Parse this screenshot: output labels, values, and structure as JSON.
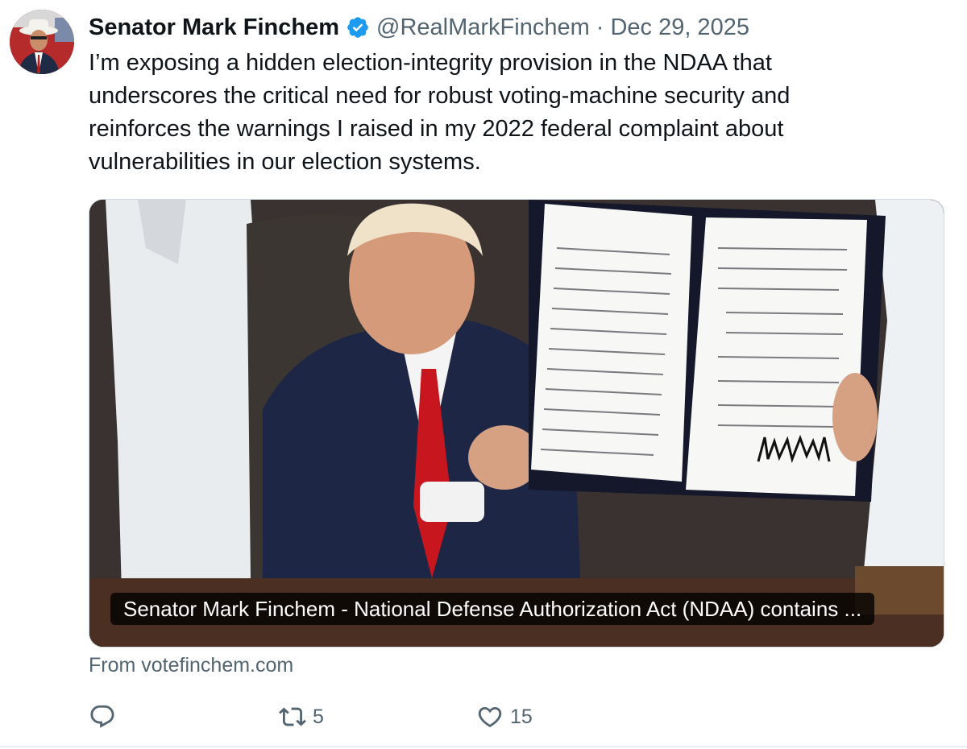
{
  "tweet": {
    "author_name": "Senator Mark Finchem",
    "handle": "@RealMarkFinchem",
    "separator": "·",
    "date": "Dec 29, 2025",
    "verified": true,
    "text_lines": [
      "I’m exposing a hidden election-integrity provision in the NDAA that",
      "underscores the critical need for robust voting-machine security and",
      "reinforces the warnings I raised in my 2022 federal complaint about",
      "vulnerabilities in our election systems."
    ]
  },
  "media": {
    "caption": "Senator Mark Finchem - National Defense Authorization Act (NDAA) contains ...",
    "source": "From votefinchem.com"
  },
  "actions": {
    "reply": {
      "icon": "reply-icon",
      "count": ""
    },
    "retweet": {
      "icon": "retweet-icon",
      "count": "5"
    },
    "like": {
      "icon": "heart-icon",
      "count": "15"
    }
  },
  "colors": {
    "verified_blue": "#1d9bf0",
    "secondary_text": "#536471",
    "primary_text": "#0f1419"
  }
}
